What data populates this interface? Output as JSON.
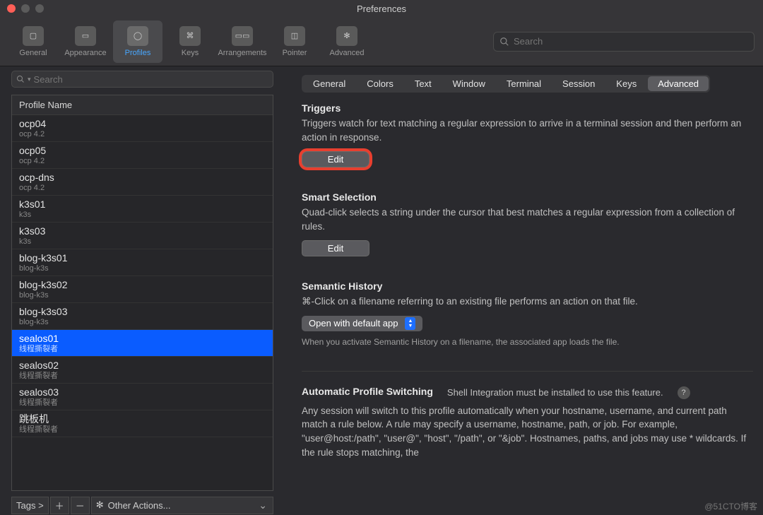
{
  "window": {
    "title": "Preferences"
  },
  "toolbar": {
    "items": [
      {
        "label": "General"
      },
      {
        "label": "Appearance"
      },
      {
        "label": "Profiles"
      },
      {
        "label": "Keys"
      },
      {
        "label": "Arrangements"
      },
      {
        "label": "Pointer"
      },
      {
        "label": "Advanced"
      }
    ],
    "active_index": 2,
    "search_placeholder": "Search"
  },
  "sidebar": {
    "search_placeholder": "Search",
    "header": "Profile Name",
    "profiles": [
      {
        "name": "ocp04",
        "sub": "ocp 4.2"
      },
      {
        "name": "ocp05",
        "sub": "ocp 4.2"
      },
      {
        "name": "ocp-dns",
        "sub": "ocp 4.2"
      },
      {
        "name": "k3s01",
        "sub": "k3s"
      },
      {
        "name": "k3s03",
        "sub": "k3s"
      },
      {
        "name": "blog-k3s01",
        "sub": "blog-k3s"
      },
      {
        "name": "blog-k3s02",
        "sub": "blog-k3s"
      },
      {
        "name": "blog-k3s03",
        "sub": "blog-k3s"
      },
      {
        "name": "sealos01",
        "sub": "线程撕裂者"
      },
      {
        "name": "sealos02",
        "sub": "线程撕裂者"
      },
      {
        "name": "sealos03",
        "sub": "线程撕裂者"
      },
      {
        "name": "跳板机",
        "sub": "线程撕裂者"
      }
    ],
    "selected_index": 8,
    "footer": {
      "tags_label": "Tags >",
      "other_actions_label": "Other Actions..."
    }
  },
  "tabs": {
    "items": [
      "General",
      "Colors",
      "Text",
      "Window",
      "Terminal",
      "Session",
      "Keys",
      "Advanced"
    ],
    "active_index": 7
  },
  "sections": {
    "triggers": {
      "title": "Triggers",
      "desc": "Triggers watch for text matching a regular expression to arrive in a terminal session and then perform an action in response.",
      "button": "Edit"
    },
    "smart_selection": {
      "title": "Smart Selection",
      "desc": "Quad-click selects a string under the cursor that best matches a regular expression from a collection of rules.",
      "button": "Edit"
    },
    "semantic_history": {
      "title": "Semantic History",
      "desc": "⌘-Click on a filename referring to an existing file performs an action on that file.",
      "dropdown": "Open with default app",
      "note": "When you activate Semantic History on a filename, the associated app loads the file."
    },
    "auto_profile": {
      "title": "Automatic Profile Switching",
      "hint": "Shell Integration must be installed to use this feature.",
      "desc": "Any session will switch to this profile automatically when your hostname, username, and current path match a rule below. A rule may specify a username, hostname, path, or job. For example, \"user@host:/path\", \"user@\", \"host\", \"/path\", or \"&job\". Hostnames, paths, and jobs may use * wildcards. If the rule stops matching, the"
    }
  },
  "watermark": "@51CTO博客"
}
